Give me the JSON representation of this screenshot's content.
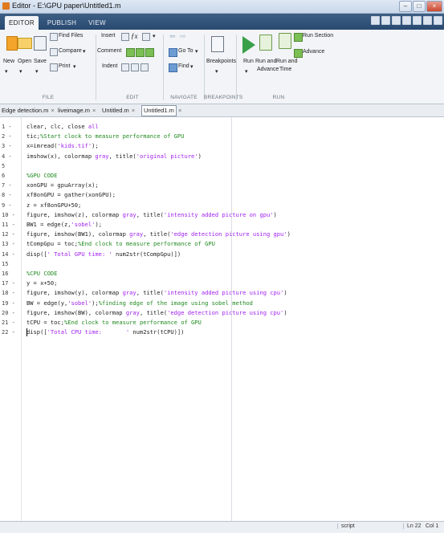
{
  "window": {
    "title": "Editor - E:\\GPU paper\\Untitled1.m"
  },
  "ribbon_tabs": [
    "EDITOR",
    "PUBLISH",
    "VIEW"
  ],
  "toolbar": {
    "file": {
      "new": "New",
      "open": "Open",
      "save": "Save",
      "find_files": "Find Files",
      "compare": "Compare",
      "print": "Print",
      "label": "FILE"
    },
    "edit": {
      "insert": "Insert",
      "comment": "Comment",
      "indent": "Indent",
      "label": "EDIT"
    },
    "navigate": {
      "go_to": "Go To",
      "find": "Find",
      "label": "NAVIGATE"
    },
    "breakpoints": {
      "breakpoints": "Breakpoints",
      "label": "BREAKPOINTS"
    },
    "run": {
      "run": "Run",
      "run_and_advance_1": "Run and",
      "run_and_advance_2": "Advance",
      "run_and_time_1": "Run and",
      "run_and_time_2": "Time",
      "run_section": "Run Section",
      "advance": "Advance",
      "label": "RUN"
    }
  },
  "file_tabs": [
    {
      "label": "Edge detection.m",
      "active": false
    },
    {
      "label": "liveimage.m",
      "active": false
    },
    {
      "label": "Untitled.m",
      "active": false
    },
    {
      "label": "Untitled1.m",
      "active": true
    }
  ],
  "editor": {
    "lines": [
      {
        "n": "1 -",
        "parts": [
          [
            "txt",
            "clear, clc, close "
          ],
          [
            "str",
            "all"
          ]
        ]
      },
      {
        "n": "2 -",
        "parts": [
          [
            "txt",
            "tic;"
          ],
          [
            "cmt",
            "%Start clock to measure performance of GPU"
          ]
        ]
      },
      {
        "n": "3 -",
        "parts": [
          [
            "txt",
            "x=imread("
          ],
          [
            "str",
            "'kids.tif'"
          ],
          [
            "txt",
            ");"
          ]
        ]
      },
      {
        "n": "4 -",
        "parts": [
          [
            "txt",
            "imshow(x), colormap "
          ],
          [
            "str",
            "gray"
          ],
          [
            "txt",
            ", title("
          ],
          [
            "str",
            "'original picture'"
          ],
          [
            "txt",
            ")"
          ]
        ]
      },
      {
        "n": "5",
        "parts": []
      },
      {
        "n": "6",
        "parts": [
          [
            "cmt",
            "%GPU CODE"
          ]
        ]
      },
      {
        "n": "7 -",
        "parts": [
          [
            "txt",
            "xonGPU = gpuArray(x);"
          ]
        ]
      },
      {
        "n": "8 -",
        "parts": [
          [
            "txt",
            "xf8onGPU = gather(xonGPU);"
          ]
        ]
      },
      {
        "n": "9 -",
        "parts": [
          [
            "txt",
            "z = xf8onGPU+50;"
          ]
        ]
      },
      {
        "n": "10 -",
        "parts": [
          [
            "txt",
            "figure, imshow(z), colormap "
          ],
          [
            "str",
            "gray"
          ],
          [
            "txt",
            ", title("
          ],
          [
            "str",
            "'intensity added picture on gpu'"
          ],
          [
            "txt",
            ")"
          ]
        ]
      },
      {
        "n": "11 -",
        "parts": [
          [
            "txt",
            "BW1 = edge(z,"
          ],
          [
            "str",
            "'sobel'"
          ],
          [
            "txt",
            ");"
          ]
        ]
      },
      {
        "n": "12 -",
        "parts": [
          [
            "txt",
            "figure, imshow(BW1), colormap "
          ],
          [
            "str",
            "gray"
          ],
          [
            "txt",
            ", title("
          ],
          [
            "str",
            "'edge detection picture using gpu'"
          ],
          [
            "txt",
            ")"
          ]
        ]
      },
      {
        "n": "13 -",
        "parts": [
          [
            "txt",
            "tCompGpu = toc;"
          ],
          [
            "cmt",
            "%End clock to measure performance of GPU"
          ]
        ]
      },
      {
        "n": "14 -",
        "parts": [
          [
            "txt",
            "disp(["
          ],
          [
            "str",
            "' Total GPU time: '"
          ],
          [
            "txt",
            " num2str(tCompGpu)])"
          ]
        ]
      },
      {
        "n": "15",
        "parts": []
      },
      {
        "n": "16",
        "parts": [
          [
            "cmt",
            "%CPU CODE"
          ]
        ]
      },
      {
        "n": "17 -",
        "parts": [
          [
            "txt",
            "y = x+50;"
          ]
        ]
      },
      {
        "n": "18 -",
        "parts": [
          [
            "txt",
            "figure, imshow(y), colormap "
          ],
          [
            "str",
            "gray"
          ],
          [
            "txt",
            ", title("
          ],
          [
            "str",
            "'intensity added picture using cpu'"
          ],
          [
            "txt",
            ")"
          ]
        ]
      },
      {
        "n": "19 -",
        "parts": [
          [
            "txt",
            "BW = edge(y,"
          ],
          [
            "str",
            "'sobel'"
          ],
          [
            "txt",
            ");"
          ],
          [
            "cmt",
            "%finding edge of the image using sobel method"
          ]
        ]
      },
      {
        "n": "20 -",
        "parts": [
          [
            "txt",
            "figure, imshow(BW), colormap "
          ],
          [
            "str",
            "gray"
          ],
          [
            "txt",
            ", title("
          ],
          [
            "str",
            "'edge detection picture using cpu'"
          ],
          [
            "txt",
            ")"
          ]
        ]
      },
      {
        "n": "21 -",
        "parts": [
          [
            "txt",
            "tCPU = toc;"
          ],
          [
            "cmt",
            "%End clock to measure performance of GPU"
          ]
        ]
      },
      {
        "n": "22 -",
        "parts": [
          [
            "txt",
            "disp(["
          ],
          [
            "str",
            "'Total CPU time:       '"
          ],
          [
            "txt",
            " num2str(tCPU)])"
          ]
        ]
      }
    ]
  },
  "status": {
    "mode": "script",
    "line": "Ln 22",
    "col": "Col 1"
  },
  "colors": {
    "keyword": "#1a1aa6",
    "string": "#a020f0",
    "comment": "#228b22"
  }
}
